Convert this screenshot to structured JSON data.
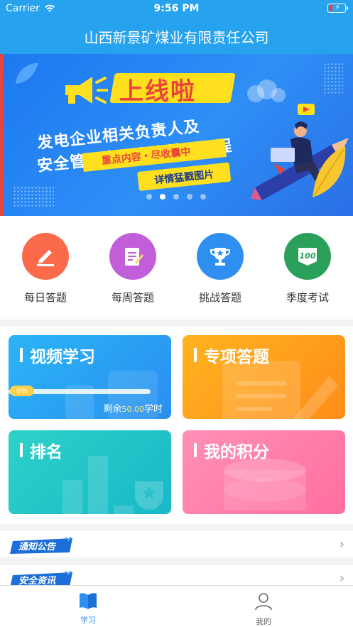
{
  "status_bar": {
    "carrier": "Carrier",
    "time": "9:56 PM"
  },
  "header": {
    "title": "山西新景矿煤业有限责任公司"
  },
  "banner": {
    "headline": "上线啦",
    "line1": "发电企业相关负责人及",
    "line2": "安全管理人员安全培训课程",
    "tag": "重点内容・尽收囊中",
    "detail": "详情猛戳图片",
    "page_count": 5,
    "active_page": 2
  },
  "quick_actions": [
    {
      "label": "每日答题",
      "icon": "pencil-icon",
      "color": "#fb6a4a"
    },
    {
      "label": "每周答题",
      "icon": "notepad-icon",
      "color": "#c25ed8"
    },
    {
      "label": "挑战答题",
      "icon": "trophy-icon",
      "color": "#2f8ff0"
    },
    {
      "label": "季度考试",
      "icon": "score-100-icon",
      "color": "#2aa05a"
    }
  ],
  "cards": {
    "video": {
      "title": "视频学习",
      "progress_label": "0%",
      "progress": 0,
      "remain_prefix": "剩余",
      "remain_value": "50.00",
      "remain_suffix": "学时"
    },
    "special": {
      "title": "专项答题"
    },
    "ranking": {
      "title": "排名"
    },
    "points": {
      "title": "我的积分"
    }
  },
  "rows": [
    {
      "label": "通知公告"
    },
    {
      "label": "安全资讯"
    }
  ],
  "tabbar": {
    "tabs": [
      {
        "label": "学习",
        "icon": "book-icon",
        "active": true
      },
      {
        "label": "我的",
        "icon": "person-icon",
        "active": false
      }
    ],
    "active_color": "#2f8ff0",
    "inactive_color": "#666666"
  }
}
